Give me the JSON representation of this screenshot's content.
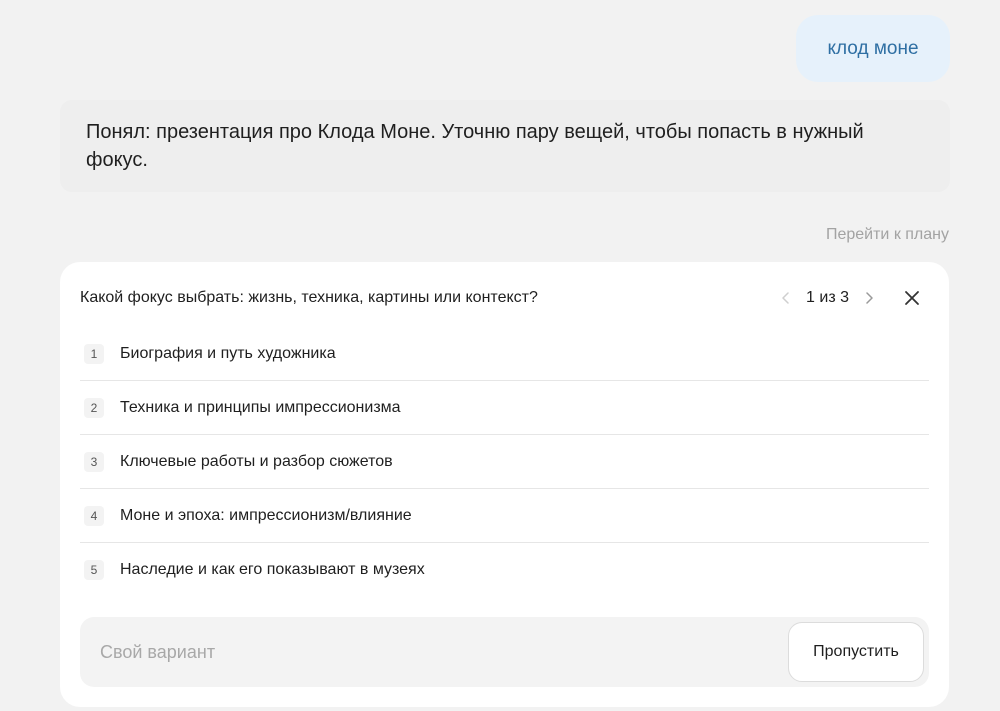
{
  "chat": {
    "user_message": "клод моне",
    "assistant_message": "Понял: презентация про Клода Моне. Уточню пару вещей, чтобы попасть в нужный фокус.",
    "plan_link": "Перейти к плану"
  },
  "question_card": {
    "question": "Какой фокус выбрать: жизнь, техника, картины или контекст?",
    "pager": "1 из 3",
    "icons": {
      "prev": "chevron-left-icon",
      "next": "chevron-right-icon",
      "close": "close-icon"
    },
    "options": [
      {
        "number": "1",
        "label": "Биография и путь художника"
      },
      {
        "number": "2",
        "label": "Техника и принципы импрессионизма"
      },
      {
        "number": "3",
        "label": "Ключевые работы и разбор сюжетов"
      },
      {
        "number": "4",
        "label": "Моне и эпоха: импрессионизм/влияние"
      },
      {
        "number": "5",
        "label": "Наследие и как его показывают в музеях"
      }
    ],
    "custom_input": {
      "value": "",
      "placeholder": "Свой вариант"
    },
    "skip_label": "Пропустить"
  },
  "colors": {
    "page_background": "#f2f2f2",
    "user_bubble": "#e6f1fb",
    "user_text": "#2f6fa3",
    "card_background": "#ffffff"
  }
}
